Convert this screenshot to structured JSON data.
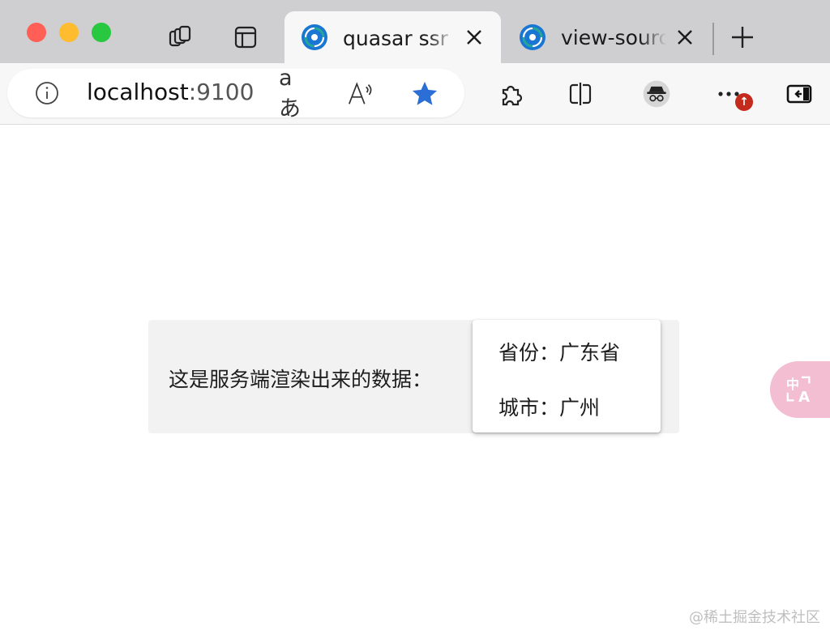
{
  "window": {
    "traffic_lights": [
      "close",
      "minimize",
      "zoom"
    ],
    "colors": {
      "close": "#ff5f57",
      "minimize": "#febc2e",
      "zoom": "#28c840"
    }
  },
  "tabs": [
    {
      "title": "quasar ssr 体验",
      "active": true,
      "favicon": "quasar-logo-icon"
    },
    {
      "title": "view-source:localhost",
      "active": false,
      "favicon": "quasar-logo-icon"
    }
  ],
  "address_bar": {
    "host": "localhost",
    "port": ":9100"
  },
  "toolbar_icons": [
    "info-icon",
    "translate-icon",
    "read-aloud-icon",
    "favorite-star-icon",
    "extensions-icon",
    "split-screen-icon",
    "inprivate-profile-icon",
    "more-icon",
    "sidebar-icon"
  ],
  "update_badge": "↑",
  "page": {
    "caption": "这是服务端渲染出来的数据：",
    "popup_rows": [
      {
        "label": "省份：",
        "value": "广东省"
      },
      {
        "label": "城市：",
        "value": "广州"
      }
    ]
  },
  "floating_translate": {
    "text": "中A"
  },
  "watermark": "@稀土掘金技术社区",
  "colors": {
    "accent_star": "#2b6fd6",
    "badge": "#c42b1c",
    "floating_bg": "#f3bdd2",
    "card_bg": "#f2f2f2"
  }
}
